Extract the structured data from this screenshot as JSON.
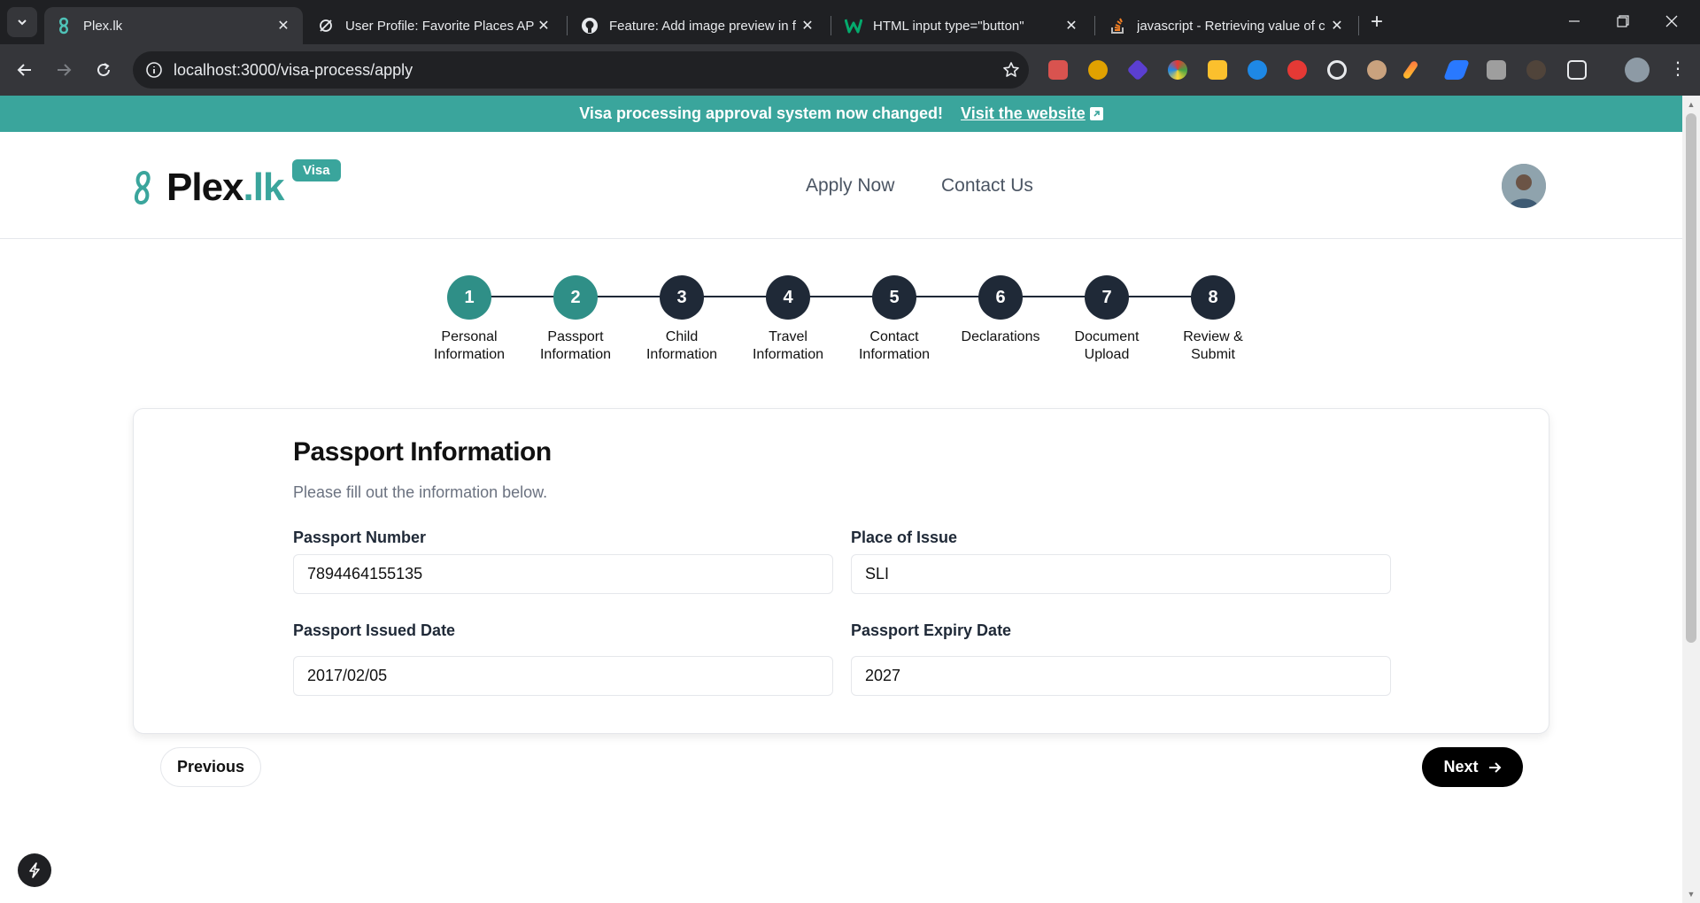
{
  "browser": {
    "tabs": [
      {
        "title": "Plex.lk",
        "icon": "plex-logo-icon",
        "active": true
      },
      {
        "title": "User Profile: Favorite Places API",
        "icon": "api-icon",
        "active": false
      },
      {
        "title": "Feature: Add image preview in f",
        "icon": "github-icon",
        "active": false
      },
      {
        "title": "HTML input type=\"button\"",
        "icon": "w3schools-icon",
        "active": false
      },
      {
        "title": "javascript - Retrieving value of c",
        "icon": "stackoverflow-icon",
        "active": false
      }
    ],
    "url": "localhost:3000/visa-process/apply"
  },
  "announcement": {
    "text": "Visa processing approval system now changed!",
    "link": "Visit the website"
  },
  "header": {
    "logo_name": "Plex",
    "logo_tld": ".lk",
    "badge": "Visa",
    "nav": [
      "Apply Now",
      "Contact Us"
    ]
  },
  "stepper": {
    "current_step": 2,
    "steps": [
      {
        "number": "1",
        "label": "Personal Information",
        "status": "complete"
      },
      {
        "number": "2",
        "label": "Passport Information",
        "status": "current"
      },
      {
        "number": "3",
        "label": "Child Information",
        "status": "pending"
      },
      {
        "number": "4",
        "label": "Travel Information",
        "status": "pending"
      },
      {
        "number": "5",
        "label": "Contact Information",
        "status": "pending"
      },
      {
        "number": "6",
        "label": "Declarations",
        "status": "pending"
      },
      {
        "number": "7",
        "label": "Document Upload",
        "status": "pending"
      },
      {
        "number": "8",
        "label": "Review & Submit",
        "status": "pending"
      }
    ]
  },
  "form": {
    "title": "Passport Information",
    "subtitle": "Please fill out the information below.",
    "fields": {
      "passport_number": {
        "label": "Passport Number",
        "value": "7894464155135"
      },
      "place_of_issue": {
        "label": "Place of Issue",
        "value": "SLI"
      },
      "issued_date": {
        "label": "Passport Issued Date",
        "value": "2017/02/05"
      },
      "expiry_date": {
        "label": "Passport Expiry Date",
        "value": "2027"
      }
    },
    "previous_label": "Previous",
    "next_label": "Next"
  },
  "colors": {
    "accent": "#3aa59c",
    "step_done": "#2f8f87",
    "step_pending": "#1f2937"
  }
}
